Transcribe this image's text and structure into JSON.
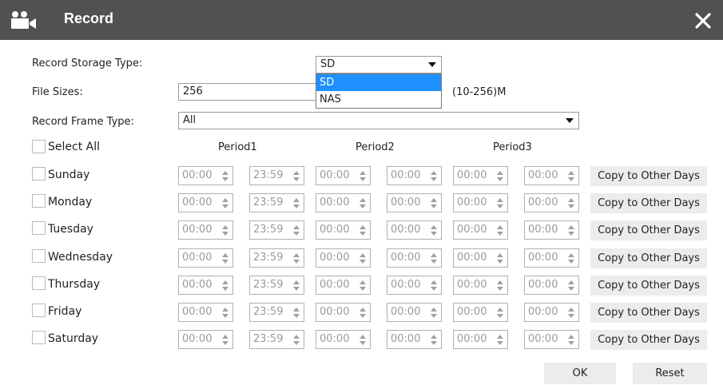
{
  "window": {
    "title": "Record",
    "close_icon": "close-icon"
  },
  "storage": {
    "label": "Record Storage Type:",
    "value": "SD",
    "options": [
      "SD",
      "NAS"
    ]
  },
  "file_sizes": {
    "label": "File Sizes:",
    "value": "256",
    "hint": "(10-256)M"
  },
  "frame_type": {
    "label": "Record Frame Type:",
    "value": "All"
  },
  "schedule": {
    "select_all": "Select All",
    "period_headers": [
      "Period1",
      "Period2",
      "Period3"
    ],
    "copy_label": "Copy to Other Days",
    "days": [
      {
        "name": "Sunday",
        "times": [
          "00:00",
          "23:59",
          "00:00",
          "00:00",
          "00:00",
          "00:00"
        ]
      },
      {
        "name": "Monday",
        "times": [
          "00:00",
          "23:59",
          "00:00",
          "00:00",
          "00:00",
          "00:00"
        ]
      },
      {
        "name": "Tuesday",
        "times": [
          "00:00",
          "23:59",
          "00:00",
          "00:00",
          "00:00",
          "00:00"
        ]
      },
      {
        "name": "Wednesday",
        "times": [
          "00:00",
          "23:59",
          "00:00",
          "00:00",
          "00:00",
          "00:00"
        ]
      },
      {
        "name": "Thursday",
        "times": [
          "00:00",
          "23:59",
          "00:00",
          "00:00",
          "00:00",
          "00:00"
        ]
      },
      {
        "name": "Friday",
        "times": [
          "00:00",
          "23:59",
          "00:00",
          "00:00",
          "00:00",
          "00:00"
        ]
      },
      {
        "name": "Saturday",
        "times": [
          "00:00",
          "23:59",
          "00:00",
          "00:00",
          "00:00",
          "00:00"
        ]
      }
    ]
  },
  "footer": {
    "ok": "OK",
    "reset": "Reset"
  },
  "colors": {
    "titlebar": "#515151",
    "dropdown_highlight": "#1e90ff",
    "button_bg": "#ececec"
  }
}
